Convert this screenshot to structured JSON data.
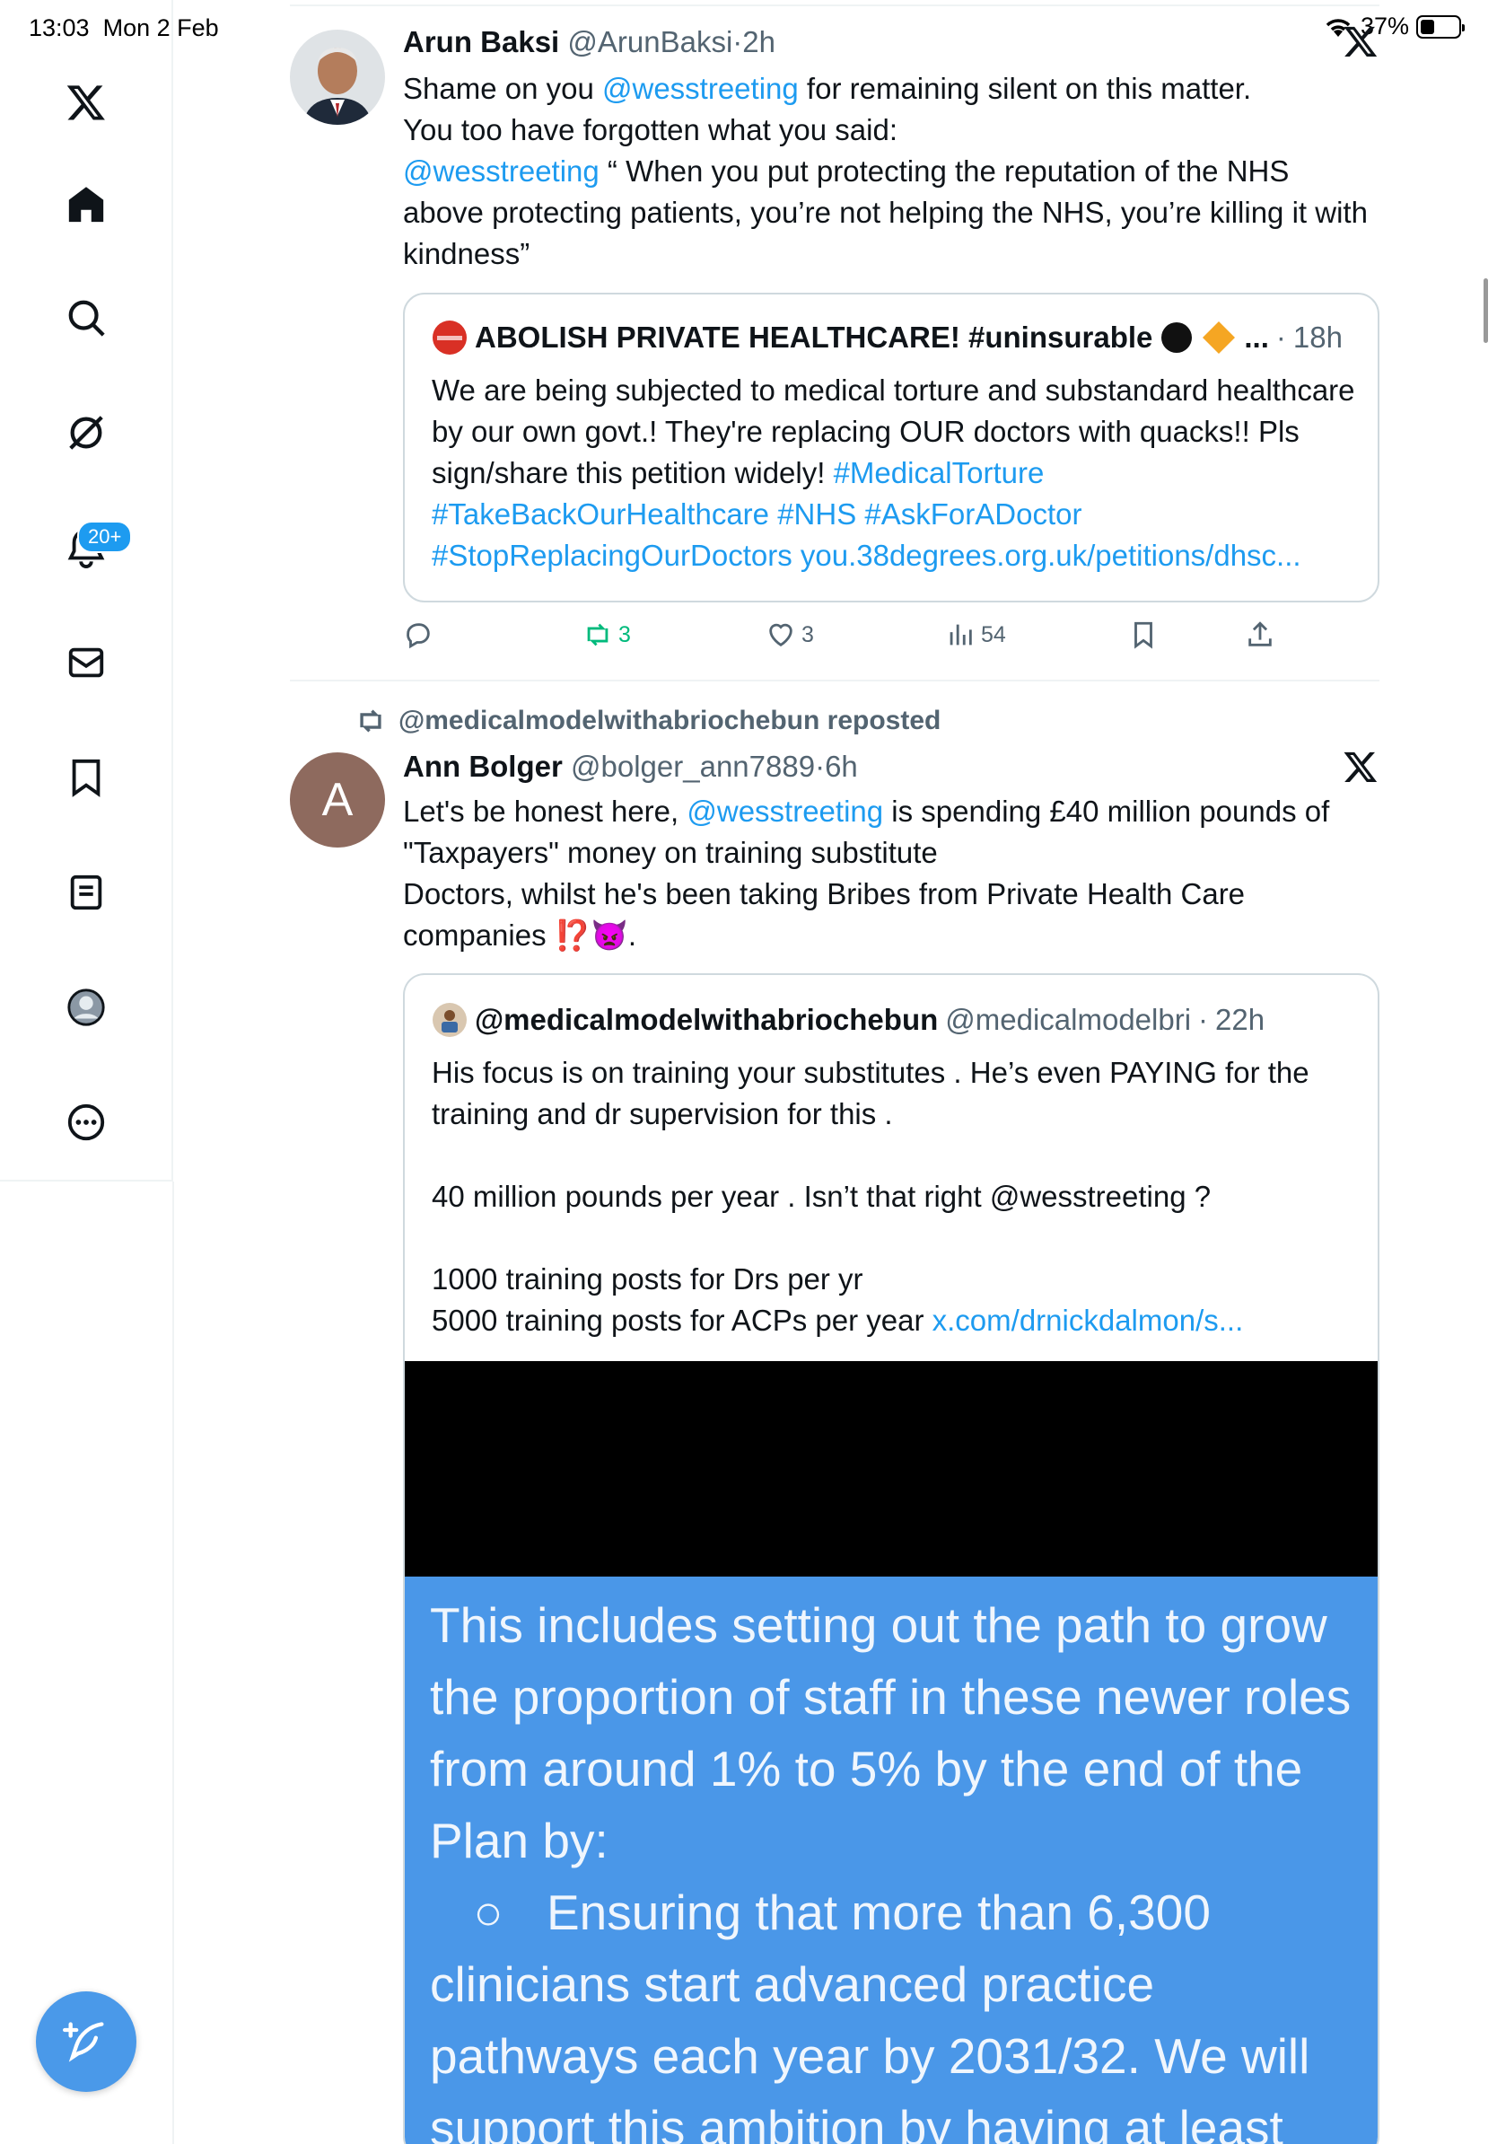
{
  "status_bar": {
    "time": "13:03",
    "date": "Mon 2 Feb",
    "battery": "37%",
    "battery_level": 0.37
  },
  "sidebar": {
    "items": [
      {
        "icon": "x-logo-icon"
      },
      {
        "icon": "home-icon"
      },
      {
        "icon": "search-icon"
      },
      {
        "icon": "grok-icon"
      },
      {
        "icon": "notifications-icon"
      },
      {
        "icon": "messages-icon"
      },
      {
        "icon": "bookmarks-icon"
      },
      {
        "icon": "lists-icon"
      },
      {
        "icon": "profile-icon"
      },
      {
        "icon": "more-icon"
      }
    ],
    "notification_badge": "20+",
    "compose_icon": "compose-icon"
  },
  "tweet1": {
    "name": "Arun Baksi",
    "handle": "@ArunBaksi",
    "sep": "·",
    "time": "2h",
    "line1_pre": "Shame on you ",
    "line1_mention": "@wesstreeting",
    "line1_post": " for remaining silent on this matter.",
    "line2": "You too have forgotten what you said:",
    "line3_mention": "@wesstreeting",
    "line3_post": " “ When you put protecting the reputation of the NHS above protecting patients, you’re not helping the NHS, you’re killing it with kindness”",
    "quote": {
      "name": "ABOLISH PRIVATE HEALTHCARE! #uninsurable",
      "name_suffix": "...",
      "time": "18h",
      "text_pre": "We are being subjected to medical torture and substandard healthcare by our own govt.! They're replacing OUR doctors with quacks!! Pls sign/share this petition widely! ",
      "tags1": "#MedicalTorture",
      "tags2": "#TakeBackOurHealthcare #NHS #AskForADoctor",
      "tags3": "#StopReplacingOurDoctors you.38degrees.org.uk/petitions/dhsc..."
    },
    "actions": {
      "reposts": "3",
      "likes": "3",
      "views": "54"
    }
  },
  "repost_banner": "@medicalmodelwithabriochebun reposted",
  "tweet2": {
    "avatar_letter": "A",
    "name": "Ann Bolger",
    "handle": "@bolger_ann7889",
    "sep": "·",
    "time": "6h",
    "line1_pre": "Let's be honest here, ",
    "line1_mention": "@wesstreeting",
    "line1_post": " is spending £40 million pounds of \"Taxpayers\" money on training substitute",
    "line2": "Doctors, whilst he's been taking Bribes from Private Health Care",
    "line3": "companies ⁉️👿.",
    "quote": {
      "name": "@medicalmodelwithabriochebun",
      "handle": "@medicalmodelbri",
      "time": "22h",
      "p1": "His focus is on training your substitutes . He’s even PAYING for the training and dr  supervision for this .",
      "p2": "40 million pounds per year . Isn’t that right @wesstreeting ?",
      "p3a": "1000 training posts for Drs per yr",
      "p3b": "5000 training posts for ACPs per year ",
      "p3_link": "x.com/drnickdalmon/s...",
      "image_text_1": "This includes setting out the path to grow the proportion of staff in these newer roles from around 1% to 5% by the end of the Plan by:",
      "image_bullet": "○",
      "image_text_2": "Ensuring that more than 6,300 clinicians start advanced practice pathways each year by 2031/32. We will support this ambition by having at least"
    }
  }
}
